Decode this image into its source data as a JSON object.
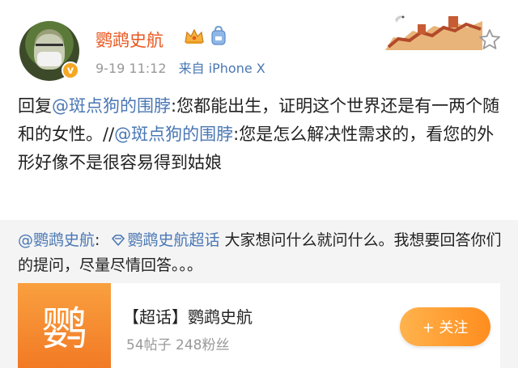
{
  "header": {
    "username": "鹦鹉史航",
    "time": "9-19 11:12",
    "source": "来自 iPhone X",
    "verified_mark": "v",
    "icons": [
      "crown-icon",
      "bag-icon",
      "great-wall-banner-icon",
      "star-icon"
    ]
  },
  "post": {
    "prefix": "回复",
    "mention1": "@斑点狗的围脖",
    "text1": ":您都能出生，证明这个世界还是有一两个随和的女性。//",
    "mention2": "@斑点狗的围脖",
    "text2": ":您是怎么解决性需求的，看您的外形好像不是很容易得到姑娘"
  },
  "quote": {
    "mention": "@鹦鹉史航",
    "colon": ":",
    "topic": "鹦鹉史航超话",
    "text": " 大家想问什么就问什么。我想要回答你们的提问，尽量尽情回答。。。"
  },
  "card": {
    "thumb_char": "鹦",
    "title": "【超话】鹦鹉史航",
    "subtitle": "54帖子 248粉丝",
    "follow_label": "+ 关注"
  },
  "colors": {
    "username": "#e8561f",
    "link": "#4a77b4",
    "accent": "#ff8d1e"
  }
}
